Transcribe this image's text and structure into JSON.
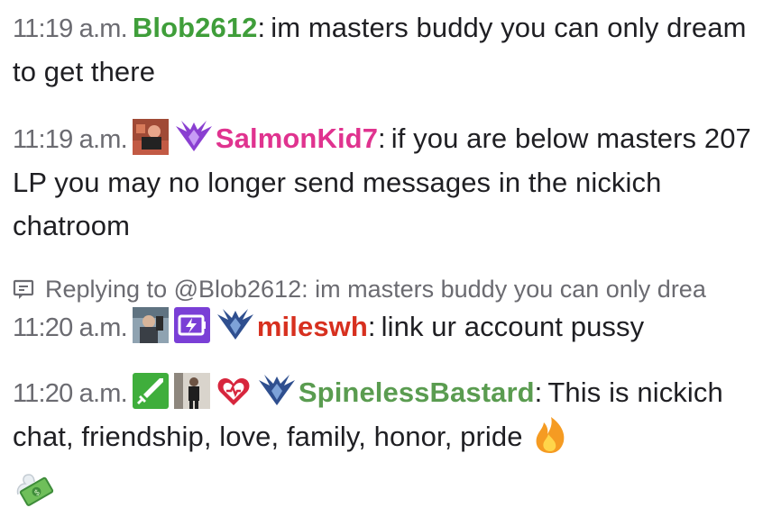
{
  "messages": [
    {
      "time": "11:19 a.m.",
      "username": "Blob2612",
      "username_color": "#3f9e3a",
      "text": "im masters buddy you can only dream to get there"
    },
    {
      "time": "11:19 a.m.",
      "username": "SalmonKid7",
      "username_color": "#e0338f",
      "badges": [
        "avatar-badge-icon",
        "purple-wings-badge-icon"
      ],
      "text": "if you are below masters 207 LP you may no longer send messages in the nickich chatroom"
    },
    {
      "reply": {
        "prefix": "Replying to @Blob2612:",
        "text": "im masters buddy you can only drea"
      },
      "time": "11:20 a.m.",
      "username": "mileswh",
      "username_color": "#d7301f",
      "badges": [
        "avatar-badge-icon",
        "lightning-subscriber-badge-icon",
        "blue-wings-badge-icon"
      ],
      "text": "link ur account pussy"
    },
    {
      "time": "11:20 a.m.",
      "username": "SpinelessBastard",
      "username_color": "#5a9c50",
      "badges": [
        "sword-badge-icon",
        "avatar-badge-icon",
        "heart-badge-icon",
        "blue-wings-badge-icon"
      ],
      "text": "This is nickich chat, friendship, love, family, honor, pride",
      "emojis": [
        "fire-emoji",
        "money-with-wings-emoji"
      ]
    }
  ],
  "colors": {
    "timestamp": "#6b6b71",
    "text": "#1f1f23"
  }
}
